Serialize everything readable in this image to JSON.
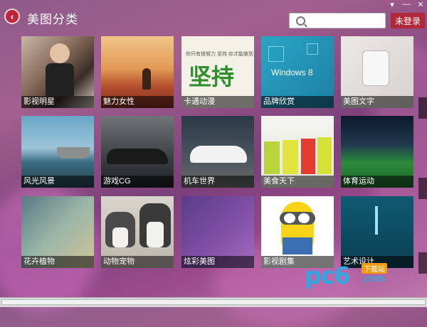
{
  "window": {
    "controls": [
      "▾",
      "—",
      "✕"
    ]
  },
  "header": {
    "title": "美图分类",
    "search_placeholder": "",
    "login_label": "未登录"
  },
  "categories": [
    {
      "label": "影视明星"
    },
    {
      "label": "魅力女性"
    },
    {
      "label": "卡通动漫",
      "art_text": "坚持",
      "art_caption": "你只有很努力 坚持 你才能做到"
    },
    {
      "label": "品牌欣赏",
      "art_text": "Windows 8"
    },
    {
      "label": "美图文字"
    },
    {
      "label": "风光风景"
    },
    {
      "label": "游戏CG"
    },
    {
      "label": "机车世界"
    },
    {
      "label": "美食天下"
    },
    {
      "label": "体育运动"
    },
    {
      "label": "花卉植物"
    },
    {
      "label": "动物宠物"
    },
    {
      "label": "炫彩美图"
    },
    {
      "label": "影视剧集"
    },
    {
      "label": "艺术设计"
    }
  ],
  "watermark": {
    "brand": "pc6",
    "domain": ".com",
    "tag": "下载站"
  }
}
